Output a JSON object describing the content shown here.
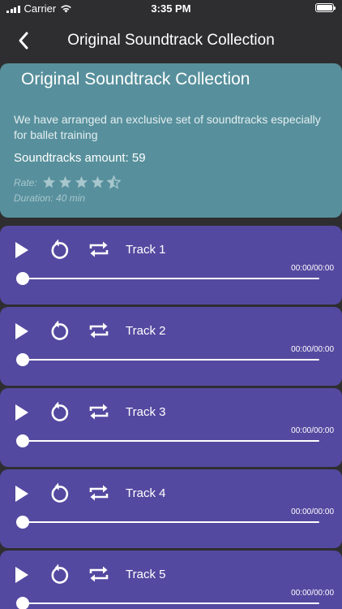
{
  "status_bar": {
    "carrier": "Carrier",
    "time": "3:35 PM"
  },
  "nav": {
    "title": "Original Soundtrack Collection",
    "back_icon": "chevron-left-icon"
  },
  "collection": {
    "title": "Original Soundtrack Collection",
    "description": "We have arranged an exclusive set of soundtracks especially for ballet training",
    "amount_label": "Soundtracks amount: 59",
    "rate_label": "Rate:",
    "rating": 4.5,
    "rating_max": 5,
    "duration_label": "Duration: 40 min"
  },
  "tracks": [
    {
      "title": "Track 1",
      "time": "00:00/00:00",
      "progress": 0
    },
    {
      "title": "Track 2",
      "time": "00:00/00:00",
      "progress": 0
    },
    {
      "title": "Track 3",
      "time": "00:00/00:00",
      "progress": 0
    },
    {
      "title": "Track 4",
      "time": "00:00/00:00",
      "progress": 0
    },
    {
      "title": "Track 5",
      "time": "00:00/00:00",
      "progress": 0
    }
  ],
  "colors": {
    "background": "#2e2e30",
    "info_card": "#57909c",
    "track_card": "#5449a0",
    "star": "#a8c6cd"
  }
}
